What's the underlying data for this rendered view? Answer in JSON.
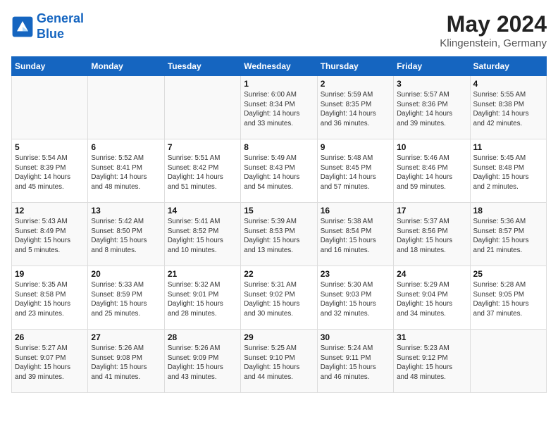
{
  "header": {
    "logo_line1": "General",
    "logo_line2": "Blue",
    "month_title": "May 2024",
    "location": "Klingenstein, Germany"
  },
  "days_of_week": [
    "Sunday",
    "Monday",
    "Tuesday",
    "Wednesday",
    "Thursday",
    "Friday",
    "Saturday"
  ],
  "weeks": [
    [
      {
        "day": "",
        "info": ""
      },
      {
        "day": "",
        "info": ""
      },
      {
        "day": "",
        "info": ""
      },
      {
        "day": "1",
        "info": "Sunrise: 6:00 AM\nSunset: 8:34 PM\nDaylight: 14 hours\nand 33 minutes."
      },
      {
        "day": "2",
        "info": "Sunrise: 5:59 AM\nSunset: 8:35 PM\nDaylight: 14 hours\nand 36 minutes."
      },
      {
        "day": "3",
        "info": "Sunrise: 5:57 AM\nSunset: 8:36 PM\nDaylight: 14 hours\nand 39 minutes."
      },
      {
        "day": "4",
        "info": "Sunrise: 5:55 AM\nSunset: 8:38 PM\nDaylight: 14 hours\nand 42 minutes."
      }
    ],
    [
      {
        "day": "5",
        "info": "Sunrise: 5:54 AM\nSunset: 8:39 PM\nDaylight: 14 hours\nand 45 minutes."
      },
      {
        "day": "6",
        "info": "Sunrise: 5:52 AM\nSunset: 8:41 PM\nDaylight: 14 hours\nand 48 minutes."
      },
      {
        "day": "7",
        "info": "Sunrise: 5:51 AM\nSunset: 8:42 PM\nDaylight: 14 hours\nand 51 minutes."
      },
      {
        "day": "8",
        "info": "Sunrise: 5:49 AM\nSunset: 8:43 PM\nDaylight: 14 hours\nand 54 minutes."
      },
      {
        "day": "9",
        "info": "Sunrise: 5:48 AM\nSunset: 8:45 PM\nDaylight: 14 hours\nand 57 minutes."
      },
      {
        "day": "10",
        "info": "Sunrise: 5:46 AM\nSunset: 8:46 PM\nDaylight: 14 hours\nand 59 minutes."
      },
      {
        "day": "11",
        "info": "Sunrise: 5:45 AM\nSunset: 8:48 PM\nDaylight: 15 hours\nand 2 minutes."
      }
    ],
    [
      {
        "day": "12",
        "info": "Sunrise: 5:43 AM\nSunset: 8:49 PM\nDaylight: 15 hours\nand 5 minutes."
      },
      {
        "day": "13",
        "info": "Sunrise: 5:42 AM\nSunset: 8:50 PM\nDaylight: 15 hours\nand 8 minutes."
      },
      {
        "day": "14",
        "info": "Sunrise: 5:41 AM\nSunset: 8:52 PM\nDaylight: 15 hours\nand 10 minutes."
      },
      {
        "day": "15",
        "info": "Sunrise: 5:39 AM\nSunset: 8:53 PM\nDaylight: 15 hours\nand 13 minutes."
      },
      {
        "day": "16",
        "info": "Sunrise: 5:38 AM\nSunset: 8:54 PM\nDaylight: 15 hours\nand 16 minutes."
      },
      {
        "day": "17",
        "info": "Sunrise: 5:37 AM\nSunset: 8:56 PM\nDaylight: 15 hours\nand 18 minutes."
      },
      {
        "day": "18",
        "info": "Sunrise: 5:36 AM\nSunset: 8:57 PM\nDaylight: 15 hours\nand 21 minutes."
      }
    ],
    [
      {
        "day": "19",
        "info": "Sunrise: 5:35 AM\nSunset: 8:58 PM\nDaylight: 15 hours\nand 23 minutes."
      },
      {
        "day": "20",
        "info": "Sunrise: 5:33 AM\nSunset: 8:59 PM\nDaylight: 15 hours\nand 25 minutes."
      },
      {
        "day": "21",
        "info": "Sunrise: 5:32 AM\nSunset: 9:01 PM\nDaylight: 15 hours\nand 28 minutes."
      },
      {
        "day": "22",
        "info": "Sunrise: 5:31 AM\nSunset: 9:02 PM\nDaylight: 15 hours\nand 30 minutes."
      },
      {
        "day": "23",
        "info": "Sunrise: 5:30 AM\nSunset: 9:03 PM\nDaylight: 15 hours\nand 32 minutes."
      },
      {
        "day": "24",
        "info": "Sunrise: 5:29 AM\nSunset: 9:04 PM\nDaylight: 15 hours\nand 34 minutes."
      },
      {
        "day": "25",
        "info": "Sunrise: 5:28 AM\nSunset: 9:05 PM\nDaylight: 15 hours\nand 37 minutes."
      }
    ],
    [
      {
        "day": "26",
        "info": "Sunrise: 5:27 AM\nSunset: 9:07 PM\nDaylight: 15 hours\nand 39 minutes."
      },
      {
        "day": "27",
        "info": "Sunrise: 5:26 AM\nSunset: 9:08 PM\nDaylight: 15 hours\nand 41 minutes."
      },
      {
        "day": "28",
        "info": "Sunrise: 5:26 AM\nSunset: 9:09 PM\nDaylight: 15 hours\nand 43 minutes."
      },
      {
        "day": "29",
        "info": "Sunrise: 5:25 AM\nSunset: 9:10 PM\nDaylight: 15 hours\nand 44 minutes."
      },
      {
        "day": "30",
        "info": "Sunrise: 5:24 AM\nSunset: 9:11 PM\nDaylight: 15 hours\nand 46 minutes."
      },
      {
        "day": "31",
        "info": "Sunrise: 5:23 AM\nSunset: 9:12 PM\nDaylight: 15 hours\nand 48 minutes."
      },
      {
        "day": "",
        "info": ""
      }
    ]
  ]
}
